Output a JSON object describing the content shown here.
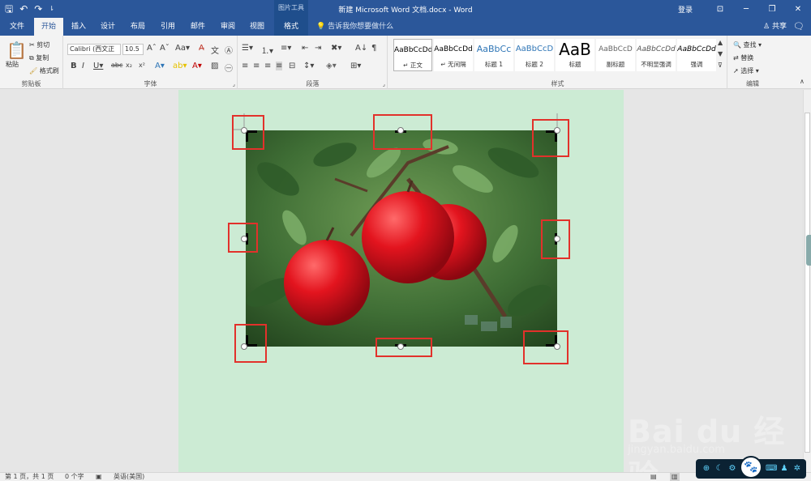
{
  "titlebar": {
    "doc_title": "新建 Microsoft Word 文档.docx - Word",
    "context_title": "图片工具",
    "login": "登录",
    "qat_icons": [
      "save-icon",
      "undo-icon",
      "redo-icon",
      "customize-qat-icon"
    ]
  },
  "tabs": {
    "file": "文件",
    "home": "开始",
    "insert": "插入",
    "design": "设计",
    "layout": "布局",
    "references": "引用",
    "mailings": "邮件",
    "review": "审阅",
    "view": "视图",
    "format": "格式",
    "tell_me": "告诉我你想要做什么",
    "share": "共享"
  },
  "clipboard": {
    "paste": "粘贴",
    "cut": "剪切",
    "copy": "复制",
    "format_painter": "格式刷",
    "label": "剪贴板"
  },
  "font": {
    "name": "Calibri (西文正",
    "size": "10.5",
    "label": "字体"
  },
  "paragraph": {
    "label": "段落"
  },
  "styles": {
    "label": "样式",
    "items": [
      {
        "sample": "AaBbCcDd",
        "name": "↵ 正文"
      },
      {
        "sample": "AaBbCcDd",
        "name": "↵ 无间隔"
      },
      {
        "sample": "AaBbCc",
        "name": "标题 1"
      },
      {
        "sample": "AaBbCcD",
        "name": "标题 2"
      },
      {
        "sample": "AaB",
        "name": "标题"
      },
      {
        "sample": "AaBbCcD",
        "name": "副标题"
      },
      {
        "sample": "AaBbCcDd",
        "name": "不明显强调"
      },
      {
        "sample": "AaBbCcDd",
        "name": "强调"
      }
    ]
  },
  "editing": {
    "find": "查找",
    "replace": "替换",
    "select": "选择",
    "label": "编辑"
  },
  "status": {
    "page": "第 1 页，共 1 页",
    "words": "0 个字",
    "language": "英语(美国)"
  },
  "watermark": {
    "main": "Bai du 经验",
    "sub": "jingyan.baidu.com"
  },
  "colors": {
    "title_bar": "#2b579a",
    "page_background": "#ccebd4",
    "highlight_box": "#e2312b"
  }
}
